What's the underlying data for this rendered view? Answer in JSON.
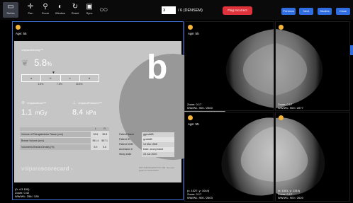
{
  "toolbar": {
    "tools": [
      {
        "label": "Series",
        "icon": "series-icon"
      },
      {
        "label": "Pan",
        "icon": "pan-icon"
      },
      {
        "label": "Zoom",
        "icon": "zoom-icon"
      },
      {
        "label": "Window",
        "icon": "window-icon"
      },
      {
        "label": "Reset",
        "icon": "reset-icon"
      },
      {
        "label": "Sync",
        "icon": "sync-icon"
      }
    ],
    "image_index": "3",
    "image_total": "/ 6 (DENSEM)",
    "red_button": "Flag Incorrect",
    "blue_buttons": [
      "Previous",
      "Next",
      "Studies",
      "Close"
    ]
  },
  "viewports": {
    "left": {
      "pane": "Age: 55",
      "bottom": "(0: 4.3 100)\nZoom: 0.42\nWW/WL: 256 / 128"
    },
    "top_middle": {
      "pane": "Age: 55",
      "bottom": "Zoom: 0.17\nWW/WL: 900 / 2600"
    },
    "top_right": {
      "pane": "",
      "bottom": "Zoom: 0.17\nWW/WL: 900 / 2677"
    },
    "bottom_middle": {
      "pane": "Age: 55",
      "bottom": "(x: 1027, y: 1044)\nZoom: 0.17\nWW/WL: 900 / 2603"
    },
    "bottom_right": {
      "pane": "",
      "bottom": "(x: 1001, y: 1315)\nZoom: 0.17\nWW/WL: 900 / 2620"
    }
  },
  "scorecard": {
    "density_label": "VolparaDensity™",
    "density_value": "5.8",
    "density_unit": "%",
    "grade": "b",
    "scale_segments": [
      "a",
      "b",
      "c",
      "d"
    ],
    "scale_ticks": [
      "3.5%",
      "7.5%",
      "15.5%"
    ],
    "dose_label": "VolparaDose™",
    "dose_value": "1.1",
    "dose_unit": "mGy",
    "pressure_label": "VolparaPressure™",
    "pressure_value": "8.4",
    "pressure_unit": "kPa",
    "table_headers": [
      "L",
      "R"
    ],
    "table_rows": [
      {
        "label": "Volume of Fibroglandular Tissue (cm³)",
        "left": "32.6",
        "right": "35.8"
      },
      {
        "label": "Breast Volume (cm³)",
        "left": "551.4",
        "right": "567.1"
      },
      {
        "label": "Volumetric Breast Density (%)",
        "left": "5.9",
        "right": "5.6"
      }
    ],
    "details": [
      {
        "key": "Patient Name",
        "value": "ggcnAAB"
      },
      {
        "key": "Patient ID",
        "value": "gcnAAB"
      },
      {
        "key": "Patient DOB",
        "value": "14 Mar 1965"
      },
      {
        "key": "Accession #",
        "value": "Date: anonymised"
      },
      {
        "key": "Study Date",
        "value": "15 Jun 2020"
      }
    ],
    "brand_main": "volpara",
    "brand_sub": "scorecard",
    "disclaimer": "NOT FOR DIAGNOSTIC USE. See user guide for interpretation."
  },
  "colors": {
    "accent_blue": "#2f6de1",
    "flag_red": "#e0323a",
    "sun": "#f4b43a"
  }
}
